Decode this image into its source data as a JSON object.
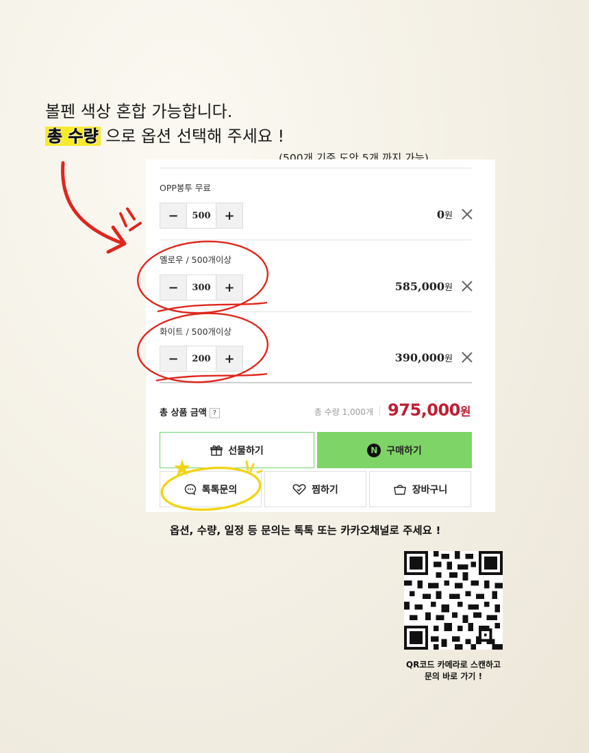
{
  "headline": {
    "line1": "볼펜 색상 혼합 가능합니다.",
    "highlight": "총 수량",
    "line2_rest": " 으로 옵션 선택해 주세요 !",
    "note": "(500개 기준 도안 5개 까지 가능)"
  },
  "options": [
    {
      "label": "OPP봉투 무료",
      "quantity": "500",
      "price": "0",
      "unit": "원"
    },
    {
      "label": "옐로우 / 500개이상",
      "quantity": "300",
      "price": "585,000",
      "unit": "원"
    },
    {
      "label": "화이트 / 500개이상",
      "quantity": "200",
      "price": "390,000",
      "unit": "원"
    }
  ],
  "stepper": {
    "minus": "−",
    "plus": "+"
  },
  "total": {
    "label": "총 상품 금액",
    "help": "?",
    "quantity_text": "총 수량 1,000개",
    "amount": "975,000",
    "unit": "원"
  },
  "buttons": {
    "gift": "선물하기",
    "buy": "구매하기",
    "buy_badge": "N",
    "talk": "톡톡문의",
    "wish": "찜하기",
    "cart": "장바구니"
  },
  "footer": {
    "note": "옵션, 수량, 일정 등 문의는 톡톡 또는 카카오채널로 주세요 !",
    "qr_caption_line1": "QR코드 카메라로 스캔하고",
    "qr_caption_line2": "문의 바로 가기 !"
  },
  "colors": {
    "accent_green": "#7ed466",
    "price_red": "#c21c33",
    "annotation_red": "#e0261c",
    "annotation_yellow": "#f2d417",
    "highlight_yellow": "#f7ea2a"
  }
}
